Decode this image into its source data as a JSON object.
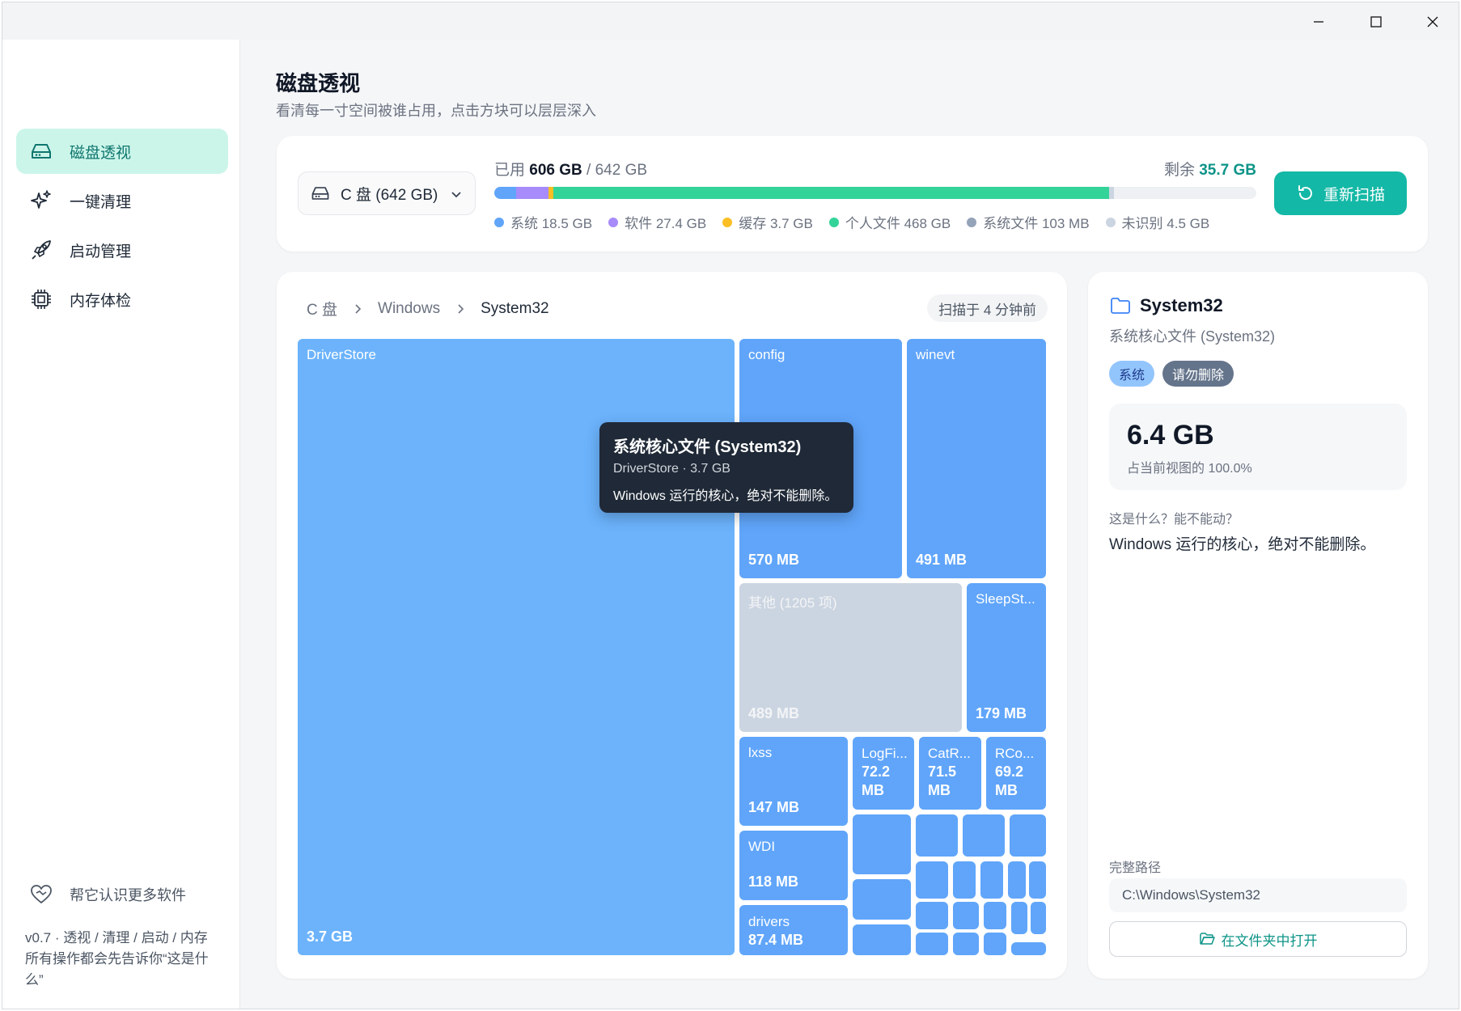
{
  "sidebar": {
    "items": [
      {
        "label": "磁盘透视",
        "icon": "hard-drive-icon"
      },
      {
        "label": "一键清理",
        "icon": "sparkles-icon"
      },
      {
        "label": "启动管理",
        "icon": "rocket-icon"
      },
      {
        "label": "内存体检",
        "icon": "cpu-chip-icon"
      }
    ],
    "help_label": "帮它认识更多软件",
    "footer_line1": "v0.7 · 透视 / 清理 / 启动 / 内存",
    "footer_line2": "所有操作都会先告诉你“这是什么”"
  },
  "header": {
    "title": "磁盘透视",
    "subtitle": "看清每一寸空间被谁占用，点击方块可以层层深入"
  },
  "disk": {
    "drive_selected": "C 盘 (642 GB)",
    "used_prefix": "已用 ",
    "used": "606 GB",
    "total_sep": " / 642 GB",
    "remaining_prefix": "剩余 ",
    "remaining": "35.7 GB",
    "rescan_label": "重新扫描",
    "segments": [
      {
        "label": "系统 18.5 GB",
        "color": "#60a5fa",
        "fraction": 0.0288
      },
      {
        "label": "软件 27.4 GB",
        "color": "#a78bfa",
        "fraction": 0.0427
      },
      {
        "label": "缓存 3.7 GB",
        "color": "#fbbf24",
        "fraction": 0.0058
      },
      {
        "label": "个人文件 468 GB",
        "color": "#34d399",
        "fraction": 0.729
      },
      {
        "label": "系统文件 103 MB",
        "color": "#94a3b8",
        "fraction": 0.0002
      },
      {
        "label": "未识别 4.5 GB",
        "color": "#cbd5e1",
        "fraction": 0.007
      }
    ]
  },
  "treemap": {
    "breadcrumb": [
      "C 盘",
      "Windows",
      "System32"
    ],
    "scanned": "扫描于 4 分钟前",
    "tiles": {
      "driverstore": {
        "name": "DriverStore",
        "size": "3.7 GB"
      },
      "config": {
        "name": "config",
        "size": "570 MB"
      },
      "winevt": {
        "name": "winevt",
        "size": "491 MB"
      },
      "other": {
        "name": "其他 (1205 项)",
        "size": "489 MB"
      },
      "sleepstudy": {
        "name": "SleepSt...",
        "size": "179 MB"
      },
      "lxss": {
        "name": "lxss",
        "size": "147 MB"
      },
      "logfiles": {
        "name": "LogFi...",
        "size_a": "72.2",
        "size_b": "MB"
      },
      "catroot": {
        "name": "CatR...",
        "size_a": "71.5",
        "size_b": "MB"
      },
      "rco": {
        "name": "RCo...",
        "size_a": "69.2",
        "size_b": "MB"
      },
      "wdi": {
        "name": "WDI",
        "size": "118 MB"
      },
      "drivers": {
        "name": "drivers",
        "size": "87.4 MB"
      }
    },
    "tooltip": {
      "title": "系统核心文件 (System32)",
      "sub": "DriverStore · 3.7 GB",
      "desc": "Windows 运行的核心，绝对不能删除。"
    }
  },
  "detail": {
    "name": "System32",
    "subtitle": "系统核心文件 (System32)",
    "tags": [
      "系统",
      "请勿删除"
    ],
    "size": "6.4 GB",
    "percent": "占当前视图的 100.0%",
    "question": "这是什么？能不能动？",
    "answer": "Windows 运行的核心，绝对不能删除。",
    "path_label": "完整路径",
    "path": "C:\\Windows\\System32",
    "open_label": "在文件夹中打开"
  }
}
